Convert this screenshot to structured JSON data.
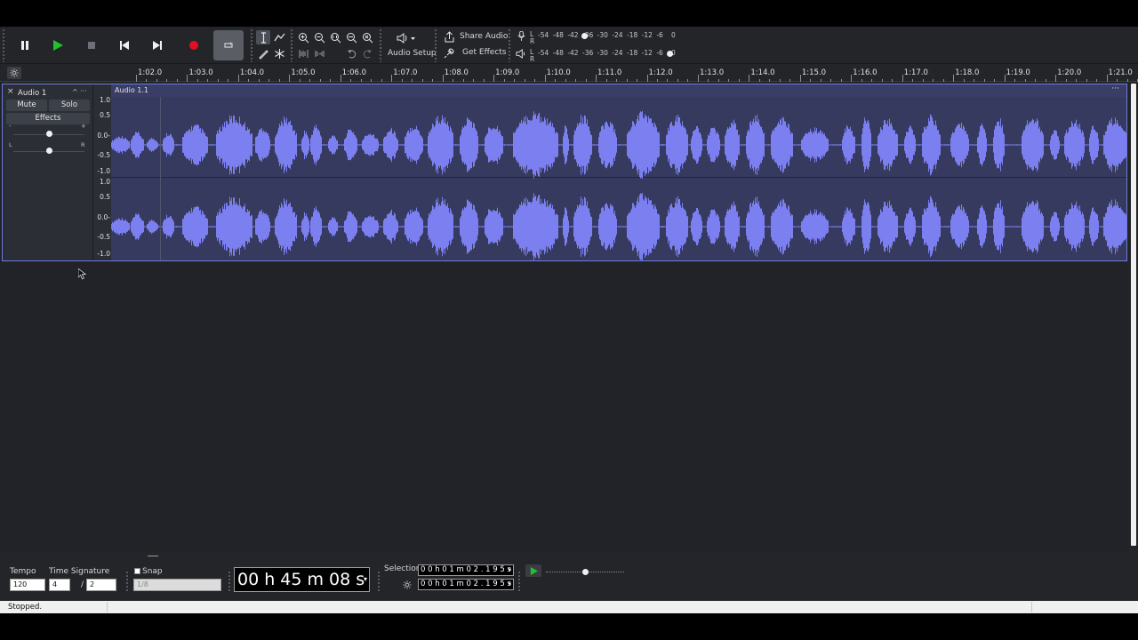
{
  "transport": {
    "buttons": [
      "pause",
      "play",
      "stop",
      "skip-to-start",
      "skip-to-end",
      "record",
      "loop"
    ]
  },
  "toolbar": {
    "audio_setup_label": "Audio Setup",
    "share_audio_label": "Share Audio",
    "get_effects_label": "Get Effects"
  },
  "meters": {
    "record_scale": [
      "-54",
      "-48",
      "-42",
      "-36",
      "-30",
      "-24",
      "-18",
      "-12",
      "-6",
      "0"
    ],
    "playback_scale": [
      "-54",
      "-48",
      "-42",
      "-36",
      "-30",
      "-24",
      "-18",
      "-12",
      "-6",
      "0"
    ],
    "channel_L": "L",
    "channel_R": "R"
  },
  "ruler": {
    "labels": [
      "1:02.0",
      "1:03.0",
      "1:04.0",
      "1:05.0",
      "1:06.0",
      "1:07.0",
      "1:08.0",
      "1:09.0",
      "1:10.0",
      "1:11.0",
      "1:12.0",
      "1:13.0",
      "1:14.0",
      "1:15.0",
      "1:16.0",
      "1:17.0",
      "1:18.0",
      "1:19.0",
      "1:20.0",
      "1:21.0"
    ]
  },
  "track": {
    "name": "Audio 1",
    "close_glyph": "×",
    "collapse_glyph": "^",
    "menu_glyph": "···",
    "mute_label": "Mute",
    "solo_label": "Solo",
    "effects_label": "Effects",
    "gain_minus": "-",
    "gain_plus": "+",
    "pan_L": "L",
    "pan_R": "R",
    "gain_value": 0.5,
    "pan_value": 0.5,
    "scale_labels": [
      "1.0",
      "0.5",
      "0.0-",
      "-0.5",
      "-1.0"
    ],
    "clip_title": "Audio 1.1",
    "clip_menu_glyph": "···"
  },
  "bottom": {
    "tempo_label": "Tempo",
    "tempo_value": "120",
    "time_signature_label": "Time Signature",
    "time_sig_upper": "4",
    "time_sig_slash": "/",
    "time_sig_lower": "2",
    "snap_label": "Snap",
    "snap_value": "1/8",
    "time_display": "00 h 45 m 08 s",
    "selection_label": "Selection",
    "selection_start": "0 0 h 0 1 m 0 2 . 1 9 5 s",
    "selection_end": "0 0 h 0 1 m 0 2 . 1 9 5 s",
    "play_speed_value": 0.5
  },
  "status": {
    "text": "Stopped."
  },
  "colors": {
    "accent": "#6b7bde",
    "waveform": "#7b7ff0",
    "record": "#e0101e",
    "play": "#22c22f"
  }
}
